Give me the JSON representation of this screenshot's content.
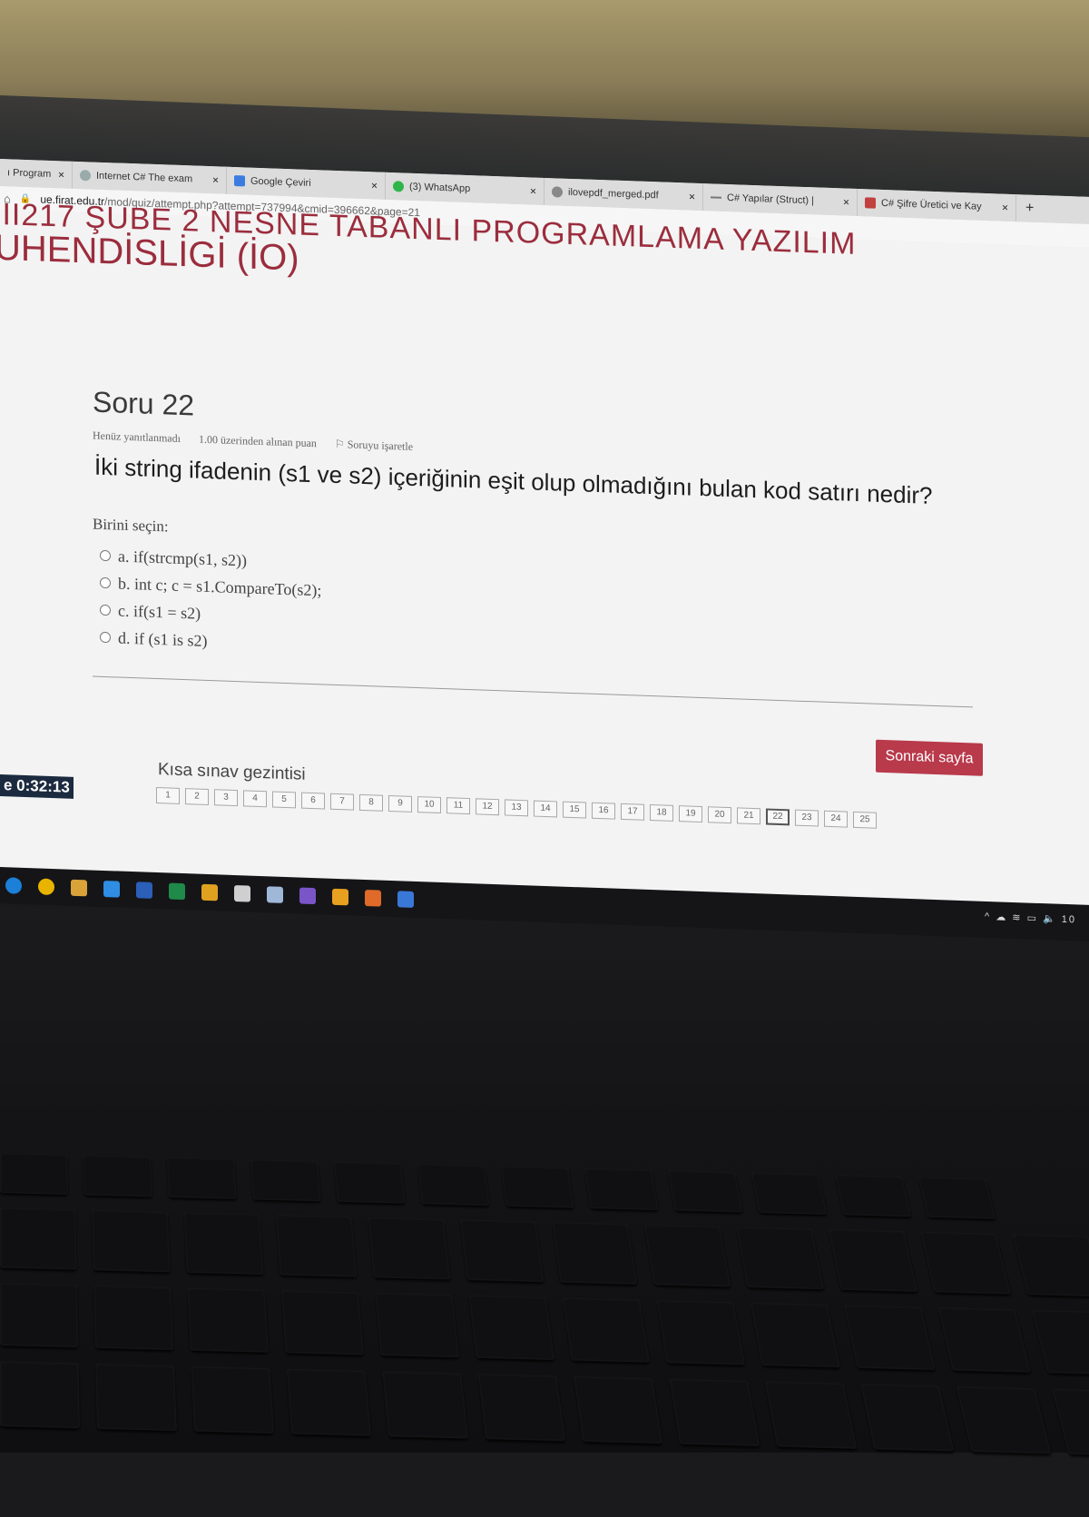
{
  "browser": {
    "tabs": [
      {
        "label": "ı Program",
        "icon": "doc-icon"
      },
      {
        "label": "Internet C# The exam",
        "icon": "globe-icon"
      },
      {
        "label": "Google Çeviri",
        "icon": "translate-icon"
      },
      {
        "label": "(3) WhatsApp",
        "icon": "whatsapp-icon"
      },
      {
        "label": "ilovepdf_merged.pdf",
        "icon": "globe-icon"
      },
      {
        "label": "C# Yapılar (Struct) |",
        "icon": "dash-icon"
      },
      {
        "label": "C# Şifre Üretici ve Kay",
        "icon": "cs-site-icon"
      }
    ],
    "close_glyph": "×",
    "new_tab_glyph": "+",
    "url_host": "ue.firat.edu.tr",
    "url_path": "/mod/quiz/attempt.php?attempt=737994&cmid=396662&page=21"
  },
  "page": {
    "course_title_line1": "III217 ŞUBE 2 NESNE TABANLI PROGRAMLAMA YAZILIM",
    "course_title_line2": "UHENDİSLİGİ (İO)"
  },
  "question": {
    "number_label": "Soru 22",
    "status": "Henüz yanıtlanmadı",
    "points": "1.00 üzerinden alınan puan",
    "flag_label": "Soruyu işaretle",
    "text": "İki string ifadenin (s1 ve s2) içeriğinin eşit olup olmadığını bulan kod satırı nedir?",
    "prompt": "Birini seçin:",
    "options": [
      "a. if(strcmp(s1, s2))",
      "b. int c; c = s1.CompareTo(s2);",
      "c. if(s1 = s2)",
      "d. if (s1 is s2)"
    ]
  },
  "next_button": "Sonraki sayfa",
  "quiz_nav": {
    "label": "Kısa sınav gezintisi",
    "timer": "e 0:32:13",
    "pages": [
      "1",
      "2",
      "3",
      "4",
      "5",
      "6",
      "7",
      "8",
      "9",
      "10",
      "11",
      "12",
      "13",
      "14",
      "15",
      "16",
      "17",
      "18",
      "19",
      "20",
      "21",
      "22",
      "23",
      "24",
      "25"
    ],
    "current": "22"
  },
  "colors": {
    "brand": "#9b2d3d",
    "button": "#b83a4b"
  },
  "taskbar": {
    "icons": [
      "edge-icon",
      "chrome-icon",
      "file-explorer-icon",
      "app-icon",
      "word-icon",
      "excel-icon",
      "photos-icon",
      "window-icon",
      "box-icon",
      "visual-studio-icon",
      "star-icon",
      "app-icon-2",
      "meet-icon"
    ],
    "tray_text": "^ ☁ ≋ ▭ 🔈 10"
  }
}
